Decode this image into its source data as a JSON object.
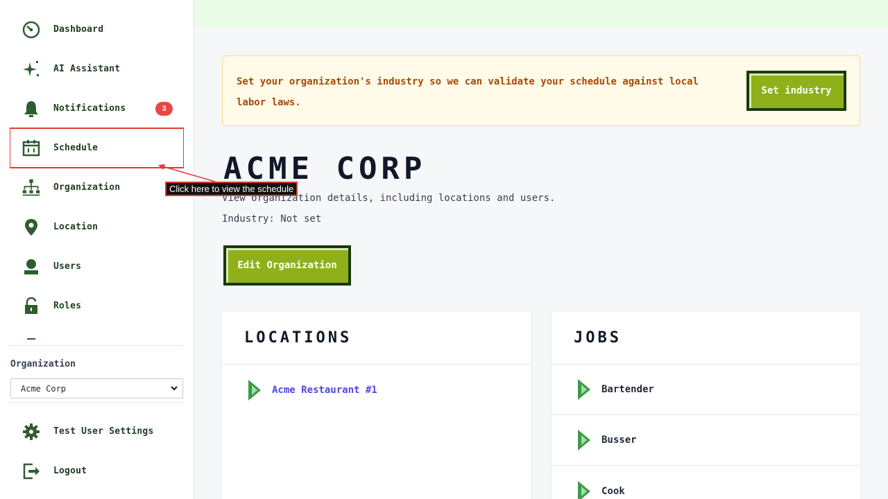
{
  "sidebar": {
    "items": [
      {
        "label": "Dashboard",
        "icon": "dashboard-icon"
      },
      {
        "label": "AI Assistant",
        "icon": "sparkle-icon"
      },
      {
        "label": "Notifications",
        "icon": "bell-icon",
        "badge": "3"
      },
      {
        "label": "Schedule",
        "icon": "calendar-icon"
      },
      {
        "label": "Organization",
        "icon": "org-chart-icon"
      },
      {
        "label": "Location",
        "icon": "map-pin-icon"
      },
      {
        "label": "Users",
        "icon": "user-icon"
      },
      {
        "label": "Roles",
        "icon": "lock-icon"
      }
    ],
    "org_label": "Organization",
    "org_selected": "Acme Corp",
    "bottom_items": [
      {
        "label": "Test User Settings",
        "icon": "gear-icon"
      },
      {
        "label": "Logout",
        "icon": "logout-icon"
      }
    ]
  },
  "alert": {
    "text": "Set your organization's industry so we can validate your schedule against local labor laws.",
    "button": "Set industry"
  },
  "main": {
    "title": "ACME CORP",
    "description": "View organization details, including locations and users.",
    "industry": "Industry: Not set",
    "edit_button": "Edit Organization"
  },
  "locations": {
    "title": "LOCATIONS",
    "items": [
      "Acme Restaurant #1"
    ]
  },
  "jobs": {
    "title": "JOBS",
    "items": [
      "Bartender",
      "Busser",
      "Cook"
    ]
  },
  "annotation": {
    "text": "Click here to view the schedule"
  },
  "colors": {
    "accent": "#8fb01a",
    "dark_green": "#173a0f",
    "badge": "#ef4444",
    "link": "#4f46e5",
    "highlight": "#e53935"
  }
}
